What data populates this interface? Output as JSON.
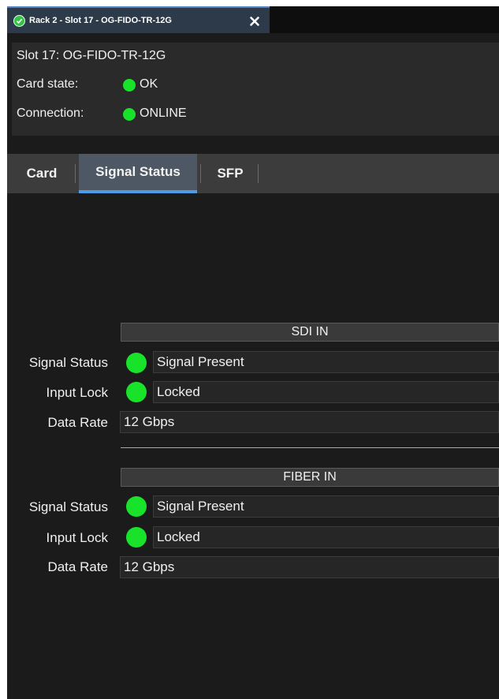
{
  "window": {
    "tab_label": "Rack 2 - Slot 17 - OG-FIDO-TR-12G",
    "tab_icon": "check-circle-icon",
    "close_icon": "close-icon"
  },
  "header": {
    "slot_title": "Slot 17: OG-FIDO-TR-12G",
    "card_state_label": "Card state:",
    "card_state_value": "OK",
    "connection_label": "Connection:",
    "connection_value": "ONLINE"
  },
  "tabs": [
    {
      "label": "Card",
      "active": false
    },
    {
      "label": "Signal Status",
      "active": true
    },
    {
      "label": "SFP",
      "active": false
    }
  ],
  "sdi_in": {
    "title": "SDI IN",
    "signal_status_label": "Signal Status",
    "signal_status_value": "Signal Present",
    "input_lock_label": "Input Lock",
    "input_lock_value": "Locked",
    "data_rate_label": "Data Rate",
    "data_rate_value": "12 Gbps"
  },
  "fiber_in": {
    "title": "FIBER IN",
    "signal_status_label": "Signal Status",
    "signal_status_value": "Signal Present",
    "input_lock_label": "Input Lock",
    "input_lock_value": "Locked",
    "data_rate_label": "Data Rate",
    "data_rate_value": "12 Gbps"
  },
  "colors": {
    "status_ok": "#18e32a",
    "active_tab_underline": "#4e9be6",
    "background": "#1b1b1b"
  }
}
